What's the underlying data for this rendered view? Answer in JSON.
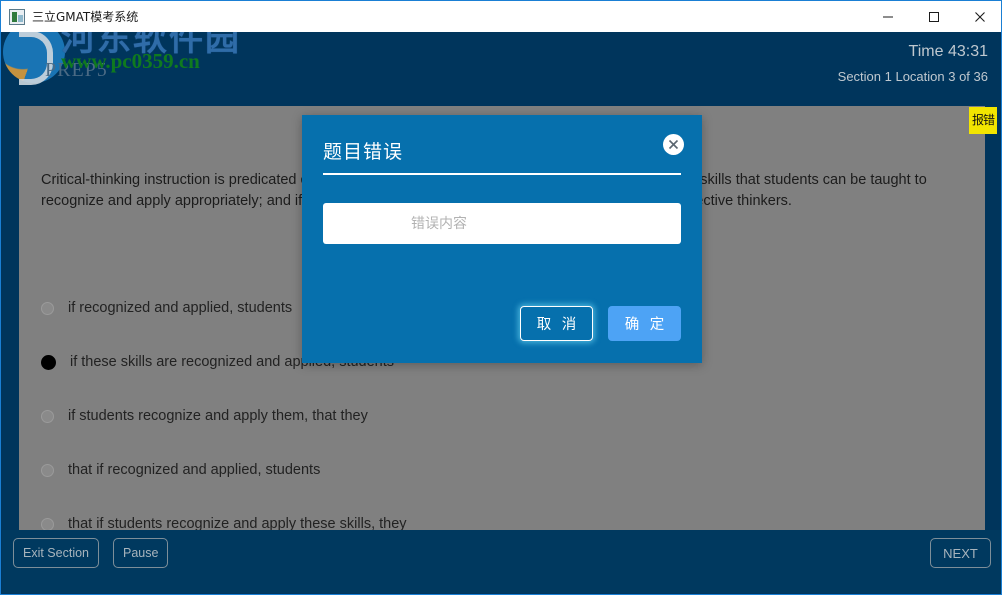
{
  "window": {
    "title": "三立GMAT模考系统",
    "controls": {
      "minimize": "minimize-icon",
      "maximize": "maximize-icon",
      "close": "close-icon"
    }
  },
  "watermark": {
    "brand_cn": "河东软件园",
    "url": "www.pc0359.cn",
    "prep_label": "PREP5"
  },
  "header": {
    "time": "Time 43:31",
    "location": "Section 1 Location 3 of 36"
  },
  "report_badge": {
    "label": "报错"
  },
  "question": {
    "text": "Critical-thinking instruction is predicated on two assumptions: that there are identifiable critical-thinking skills that students can be taught to recognize and apply appropriately; and if recognized and applied, these students will become more effective thinkers.",
    "options": [
      {
        "label": "if recognized and applied, students",
        "selected": false
      },
      {
        "label": "if these skills are recognized and applied, students",
        "selected": true
      },
      {
        "label": "if students recognize and apply them, that they",
        "selected": false
      },
      {
        "label": "that if recognized and applied, students",
        "selected": false
      },
      {
        "label": "that if students recognize and apply these skills, they",
        "selected": false
      }
    ]
  },
  "bottom_bar": {
    "exit_section": "Exit Section",
    "pause": "Pause",
    "next": "NEXT"
  },
  "dialog": {
    "title": "题目错误",
    "input_value": "",
    "input_placeholder": "错误内容",
    "cancel_label": "取 消",
    "confirm_label": "确 定",
    "close_icon": "close-circle-icon"
  },
  "colors": {
    "header_navy": "#00355c",
    "panel_gray": "#808080",
    "dialog_blue": "#0670ad",
    "confirm_blue": "#4da3f5",
    "badge_yellow": "#f2e500",
    "window_border": "#1a7fd4"
  }
}
